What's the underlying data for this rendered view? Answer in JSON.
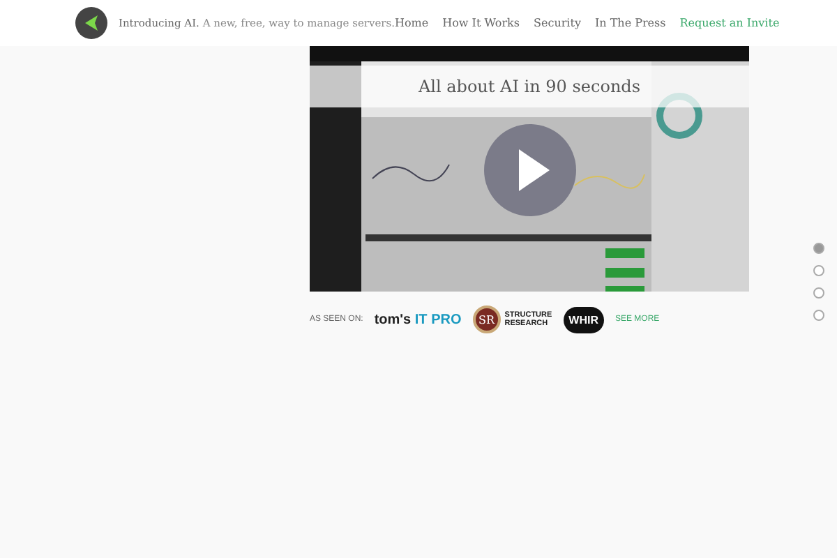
{
  "header": {
    "tagline_brand": "Introducing AI.",
    "tagline": "A new, free, way to manage servers.",
    "nav": [
      {
        "label": "Home",
        "kind": "link"
      },
      {
        "label": "How It Works",
        "kind": "link"
      },
      {
        "label": "Security",
        "kind": "link"
      },
      {
        "label": "In The Press",
        "kind": "link"
      },
      {
        "label": "Request an Invite",
        "kind": "cta"
      }
    ]
  },
  "video": {
    "title": "All about AI in 90 seconds"
  },
  "press": {
    "label": "AS SEEN ON:",
    "logos": [
      {
        "kind": "toms",
        "parts": [
          "tom's",
          "IT PR",
          "O"
        ]
      },
      {
        "kind": "sr",
        "parts": [
          "SR",
          "STRUCTURE",
          "RESEARCH"
        ]
      },
      {
        "kind": "whir",
        "parts": [
          "WHIR"
        ]
      }
    ],
    "more": "SEE MORE"
  },
  "pager": [
    {
      "selected": true
    },
    {
      "selected": false
    },
    {
      "selected": false
    },
    {
      "selected": false
    }
  ]
}
